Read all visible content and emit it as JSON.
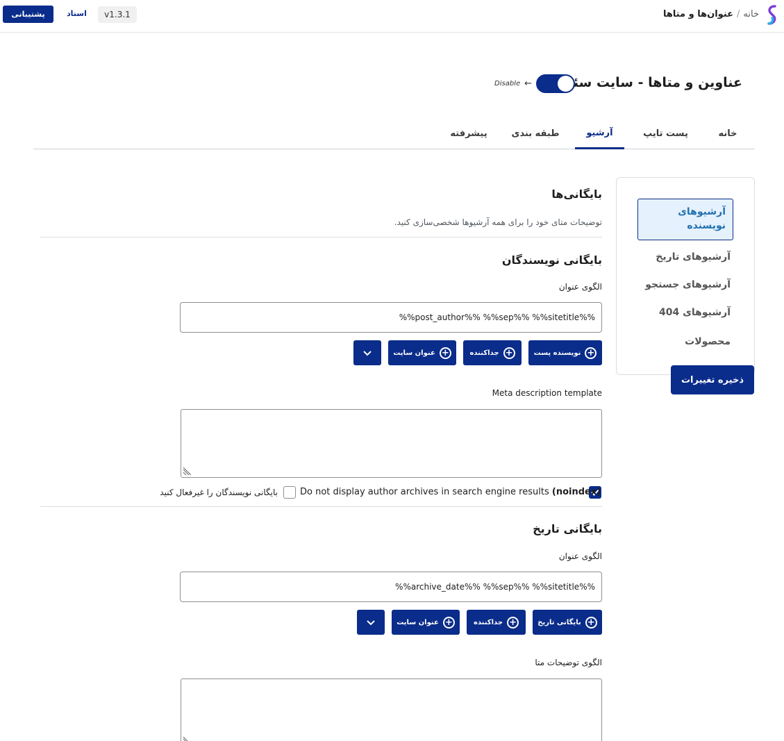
{
  "header": {
    "breadcrumb_home": "خانه",
    "breadcrumb_separator": "/",
    "breadcrumb_current": "عنوان‌ها و متاها",
    "version": "v1.3.1",
    "docs_label": "اسناد",
    "support_label": "پشتیبانی"
  },
  "page": {
    "title": "عناوین و متاها - سایت سئو",
    "toggle_label": "Disable",
    "toggle_on": true
  },
  "tabs": [
    {
      "label": "خانه"
    },
    {
      "label": "پست تایپ"
    },
    {
      "label": "آرشیو",
      "active": true
    },
    {
      "label": "طبقه بندی"
    },
    {
      "label": "پیشرفته"
    }
  ],
  "sidebar": {
    "items": [
      {
        "label": "آرشیوهای نویسنده",
        "active": true
      },
      {
        "label": "آرشیوهای تاریخ"
      },
      {
        "label": "آرشیوهای جستجو"
      },
      {
        "label": "آرشیوهای 404"
      },
      {
        "label": "محصولات"
      }
    ],
    "save_label": "ذخیره تغییرات"
  },
  "section": {
    "title": "بایگانی‌ها",
    "description": "توضیحات متای خود را برای همه آرشیوها شخصی‌سازی کنید."
  },
  "author_archive": {
    "heading": "بایگانی نویسندگان",
    "title_label": "الگوی عنوان",
    "title_value": "%%post_author%% %%sep%% %%sitetitle%%",
    "buttons": [
      "نویسنده پست",
      "جداکننده",
      "عنوان سایت"
    ],
    "meta_label": "Meta description template",
    "meta_value": "",
    "noindex_prefix": "Do not display author archives in search engine results",
    "noindex_bold": "(noindex)",
    "noindex_checked": true,
    "disable_label": "بایگانی نویسندگان را غیرفعال کنید",
    "disable_checked": false
  },
  "date_archive": {
    "heading": "بایگانی تاریخ",
    "title_label": "الگوی عنوان",
    "title_value": "%%archive_date%% %%sep%% %%sitetitle%%",
    "buttons": [
      "بایگانی تاریخ",
      "جداکننده",
      "عنوان سایت"
    ],
    "meta_label": "الگوی توضیحات متا",
    "meta_value": ""
  },
  "colors": {
    "primary": "#0a2c8a",
    "active_tab_bg": "#e5f1fc",
    "active_tab_text": "#2271b1"
  }
}
